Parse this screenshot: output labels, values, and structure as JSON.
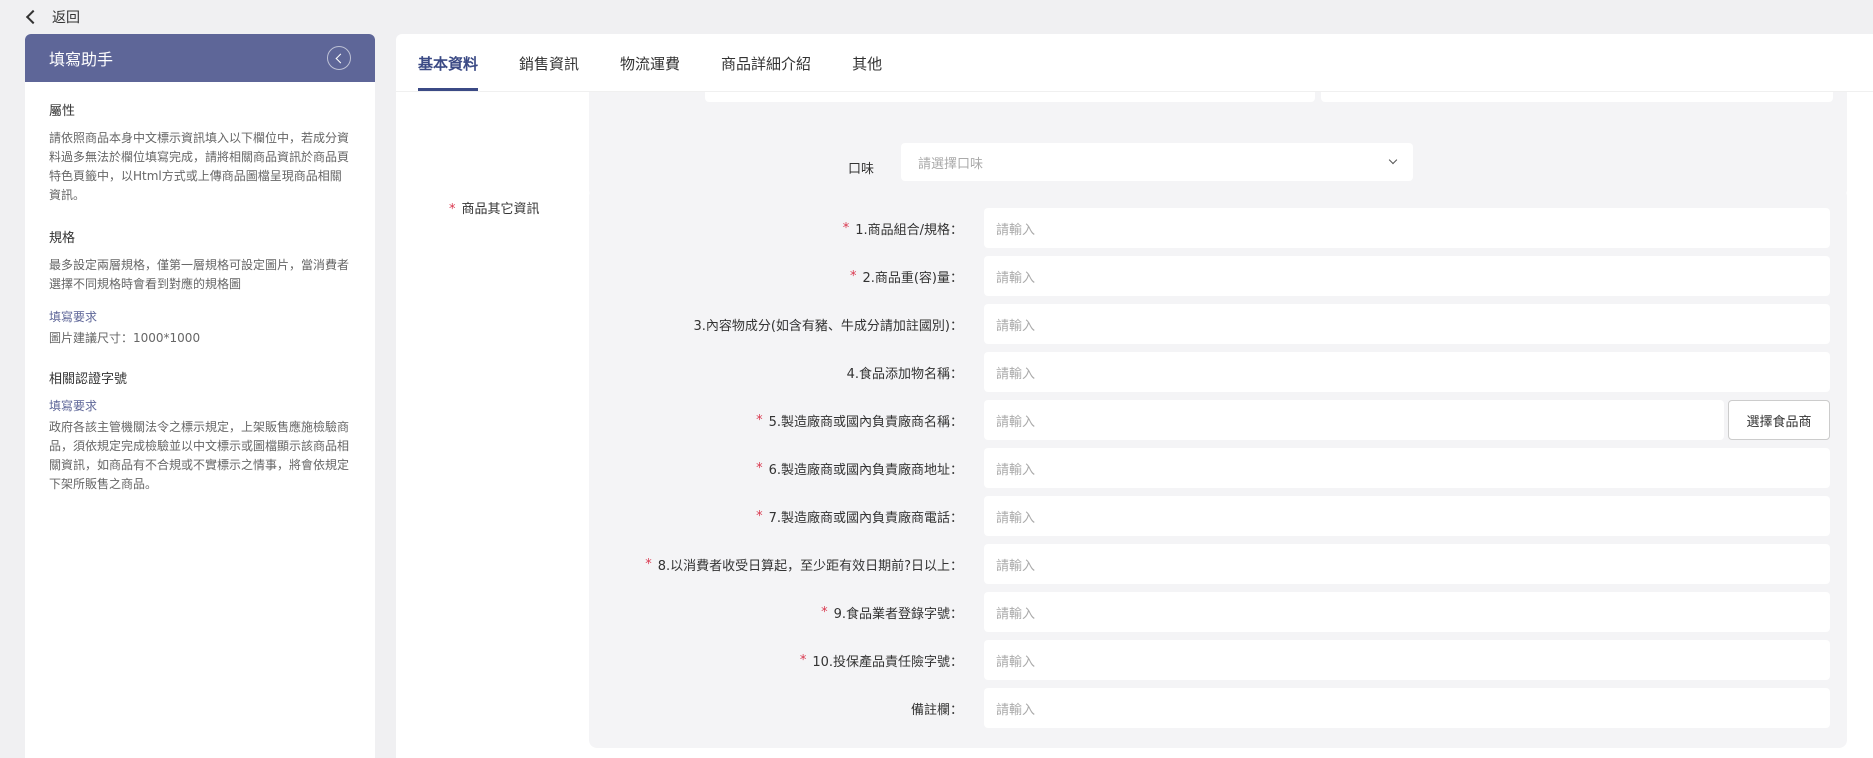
{
  "topbar": {
    "back_label": "返回"
  },
  "helper": {
    "title": "填寫助手",
    "sections": [
      {
        "title": "屬性",
        "text": "請依照商品本身中文標示資訊填入以下欄位中，若成分資料過多無法於欄位填寫完成，請將相關商品資訊於商品頁特色頁籤中，以Html方式或上傳商品圖檔呈現商品相關資訊。"
      },
      {
        "title": "規格",
        "text": "最多設定兩層規格，僅第一層規格可設定圖片，當消費者選擇不同規格時會看到對應的規格圖"
      }
    ],
    "spec_requirement_label": "填寫要求",
    "spec_requirement_text": "圖片建議尺寸：1000*1000",
    "cert": {
      "title": "相關認證字號",
      "requirement_label": "填寫要求",
      "text": "政府各該主管機關法令之標示規定，上架販售應施檢驗商品，須依規定完成檢驗並以中文標示或圖檔顯示該商品相關資訊，如商品有不合規或不實標示之情事，將會依規定下架所販售之商品。"
    }
  },
  "tabs": [
    {
      "label": "基本資料",
      "active": true
    },
    {
      "label": "銷售資訊",
      "active": false
    },
    {
      "label": "物流運費",
      "active": false
    },
    {
      "label": "商品詳細介紹",
      "active": false
    },
    {
      "label": "其他",
      "active": false
    }
  ],
  "flavor": {
    "label": "口味",
    "placeholder": "請選擇口味"
  },
  "other_info": {
    "label": "商品其它資訊",
    "required": true,
    "fields": [
      {
        "label": "1.商品組合/規格：",
        "required": true,
        "placeholder": "請輸入"
      },
      {
        "label": "2.商品重(容)量：",
        "required": true,
        "placeholder": "請輸入"
      },
      {
        "label": "3.內容物成分(如含有豬、牛成分請加註國別)：",
        "required": false,
        "placeholder": "請輸入"
      },
      {
        "label": "4.食品添加物名稱：",
        "required": false,
        "placeholder": "請輸入"
      },
      {
        "label": "5.製造廠商或國內負責廠商名稱：",
        "required": true,
        "placeholder": "請輸入",
        "button": "選擇食品商"
      },
      {
        "label": "6.製造廠商或國內負責廠商地址：",
        "required": true,
        "placeholder": "請輸入"
      },
      {
        "label": "7.製造廠商或國內負責廠商電話：",
        "required": true,
        "placeholder": "請輸入"
      },
      {
        "label": "8.以消費者收受日算起，至少距有效日期前?日以上：",
        "required": true,
        "placeholder": "請輸入"
      },
      {
        "label": "9.食品業者登錄字號：",
        "required": true,
        "placeholder": "請輸入"
      },
      {
        "label": "10.投保產品責任險字號：",
        "required": true,
        "placeholder": "請輸入"
      },
      {
        "label": "備註欄：",
        "required": false,
        "placeholder": "請輸入"
      }
    ]
  },
  "colors": {
    "accent": "#3b4a85",
    "helper_header": "#5e6698",
    "required": "#d9364d"
  }
}
